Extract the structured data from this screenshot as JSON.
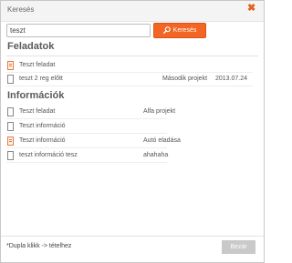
{
  "dialog": {
    "title": "Keresés",
    "close_icon": "close-x-icon",
    "accent_color": "#f26522"
  },
  "search": {
    "value": "teszt",
    "button_label": "Keresés",
    "button_icon": "magnifier-icon"
  },
  "tasks": {
    "title": "Feladatok",
    "rows": [
      {
        "icon": "orange-document-icon",
        "name": "Teszt feladat",
        "project": "",
        "date": ""
      },
      {
        "icon": "document-icon",
        "name": "teszt 2 reg előtt",
        "project": "Második projekt",
        "date": "2013.07.24"
      }
    ]
  },
  "info": {
    "title": "Információk",
    "rows": [
      {
        "icon": "document-icon",
        "name": "Teszt feladat",
        "project": "Alfa projekt"
      },
      {
        "icon": "document-icon",
        "name": "Teszt információ",
        "project": ""
      },
      {
        "icon": "orange-document-icon",
        "name": "Teszt információ",
        "project": "Autó eladása"
      },
      {
        "icon": "document-icon",
        "name": "teszt információ tesz",
        "project": "ahahaha"
      }
    ]
  },
  "footer": {
    "hint": "*Dupla klikk -> tételhez",
    "close_label": "Bezár"
  }
}
